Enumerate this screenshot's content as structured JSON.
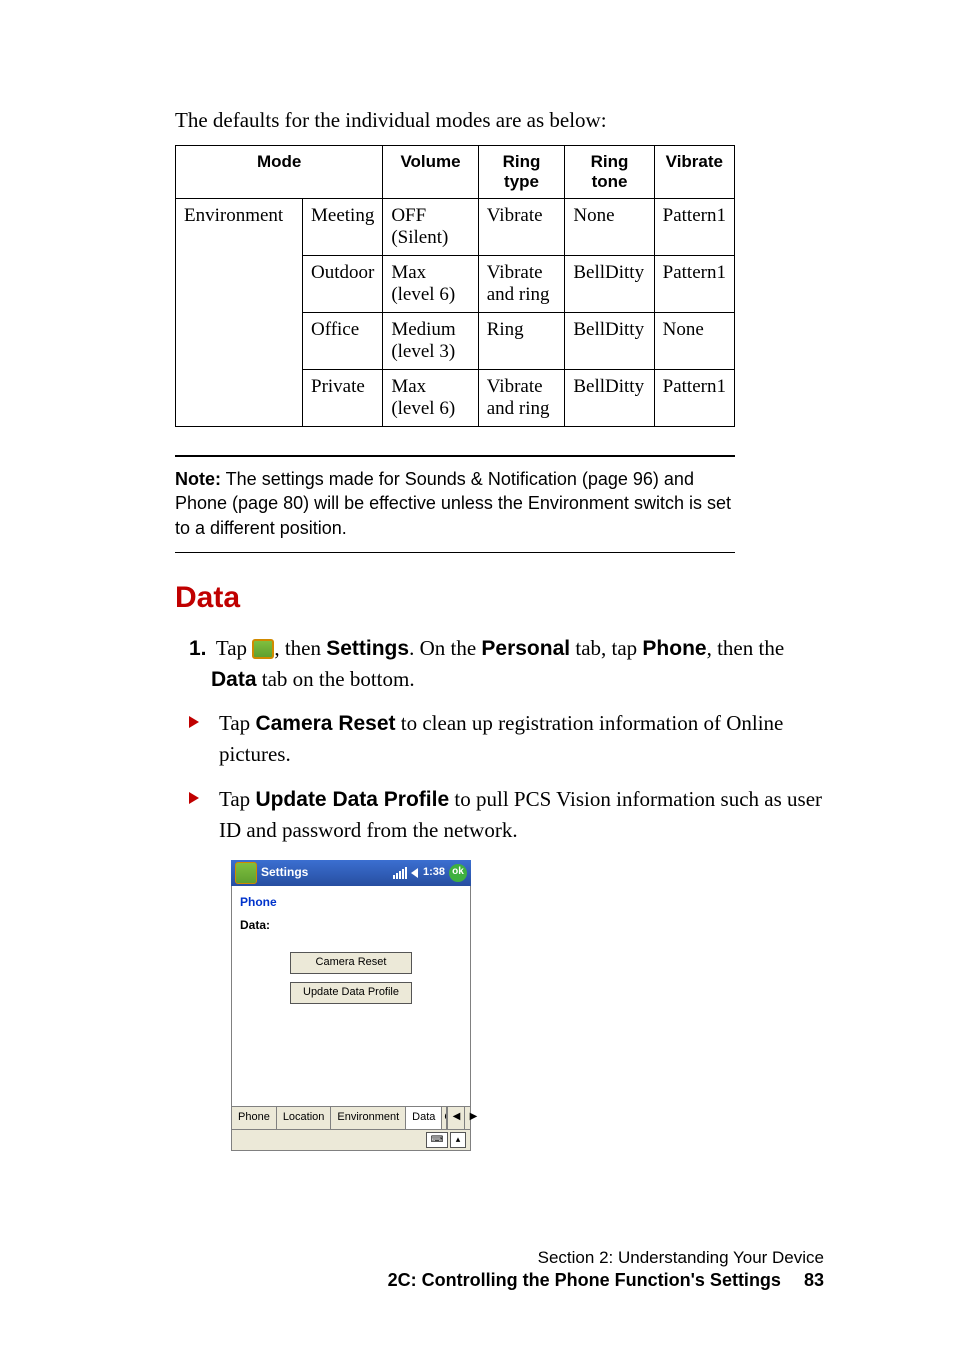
{
  "intro": "The defaults for the individual modes are as below:",
  "table": {
    "headers": {
      "mode": "Mode",
      "volume": "Volume",
      "ringtype": "Ring type",
      "ringtone": "Ring tone",
      "vibrate": "Vibrate"
    },
    "env_label": "Environment",
    "rows": [
      {
        "sub": "Meeting",
        "volume": "OFF (Silent)",
        "ringtype": "Vibrate",
        "ringtone": "None",
        "vibrate": "Pattern1"
      },
      {
        "sub": "Outdoor",
        "volume": "Max (level 6)",
        "ringtype": "Vibrate and ring",
        "ringtone": "BellDitty",
        "vibrate": "Pattern1"
      },
      {
        "sub": "Office",
        "volume": "Medium (level 3)",
        "ringtype": "Ring",
        "ringtone": "BellDitty",
        "vibrate": "None"
      },
      {
        "sub": "Private",
        "volume": "Max (level 6)",
        "ringtype": "Vibrate and ring",
        "ringtone": "BellDitty",
        "vibrate": "Pattern1"
      }
    ]
  },
  "note": {
    "label": "Note:",
    "text": " The settings made for Sounds & Notification (page 96) and Phone (page 80) will be effective unless the Environment switch is set to a different position."
  },
  "heading": "Data",
  "step1": {
    "num": "1.",
    "t1": "Tap ",
    "t2": ", then ",
    "settings": "Settings",
    "t3": ". On the ",
    "personal": "Personal",
    "t4": " tab, tap ",
    "phone": "Phone",
    "t5": ", then the ",
    "data": "Data",
    "t6": " tab on the bottom."
  },
  "bullet1": {
    "t1": "Tap ",
    "bold": "Camera Reset",
    "t2": " to clean up registration information of Online pictures."
  },
  "bullet2": {
    "t1": "Tap ",
    "bold": "Update Data Profile",
    "t2": " to pull PCS Vision information such as user ID and password from the network."
  },
  "screenshot": {
    "title": "Settings",
    "clock": "1:38",
    "ok": "ok",
    "phone": "Phone",
    "datalabel": "Data:",
    "btn1": "Camera Reset",
    "btn2": "Update Data Profile",
    "tabs": {
      "phone": "Phone",
      "location": "Location",
      "environment": "Environment",
      "data": "Data",
      "over": "O"
    },
    "kbd": "⌨",
    "up": "▴"
  },
  "footer": {
    "section": "Section 2: Understanding Your Device",
    "chapter": "2C: Controlling the Phone Function's Settings",
    "page": "83"
  }
}
